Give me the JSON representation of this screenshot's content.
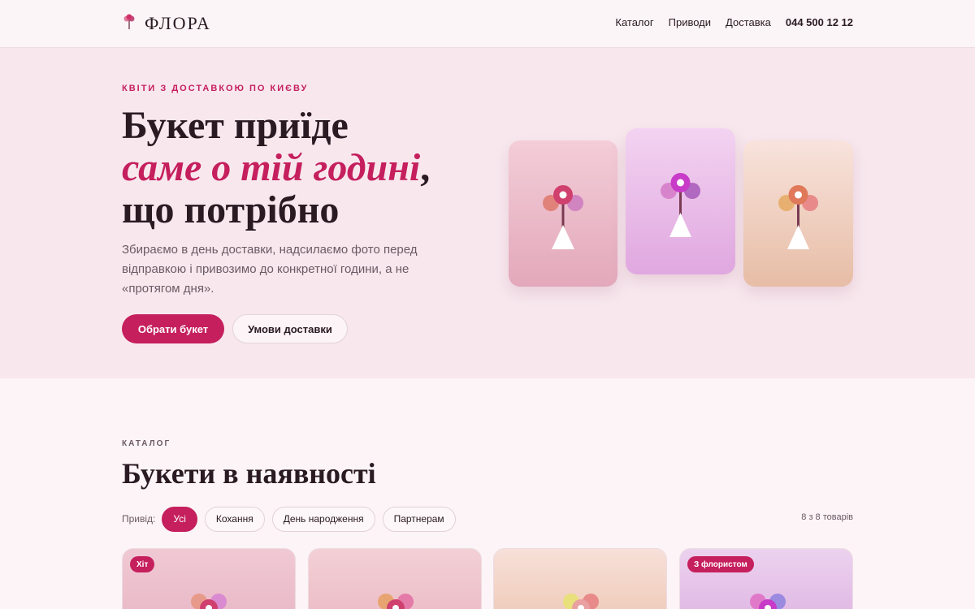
{
  "header": {
    "logo_text": "ФЛОРА",
    "logo_icon": "flower-icon",
    "nav": [
      "Каталог",
      "Приводи",
      "Доставка"
    ],
    "phone": "044 500 12 12"
  },
  "hero": {
    "eyebrow": "КВІТИ З ДОСТАВКОЮ ПО КИЄВУ",
    "title_line1": "Букет приїде",
    "title_accent": "саме о тій годині",
    "title_comma": ",",
    "title_line3": "що потрібно",
    "text": "Збираємо в день доставки, надсилаємо фото перед відправкою і привозимо до конкретної години, а не «протягом дня».",
    "primary_button": "Обрати букет",
    "secondary_button": "Умови доставки"
  },
  "catalog": {
    "label": "КАТАЛОГ",
    "title": "Букети в наявності",
    "filter_label": "Привід:",
    "filters": [
      "Усі",
      "Кохання",
      "День народження",
      "Партнерам"
    ],
    "active_filter": "Усі",
    "count": "8 з 8 товарів",
    "badges": [
      "Хіт",
      "З флористом"
    ]
  },
  "colors": {
    "accent": "#c51f5d",
    "hero_bg": "#f8e8ee",
    "page_bg": "#fcf4f7"
  }
}
